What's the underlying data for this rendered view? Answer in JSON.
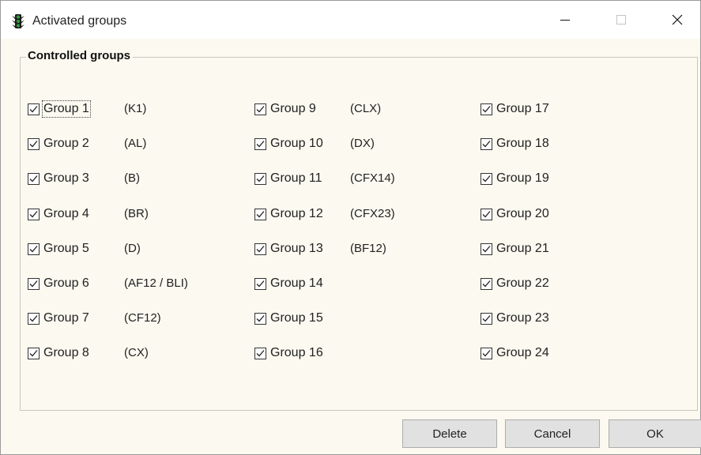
{
  "window": {
    "title": "Activated groups",
    "icon": "traffic-light-icon"
  },
  "groupbox": {
    "legend": "Controlled groups"
  },
  "columns": [
    {
      "items": [
        {
          "label": "Group 1",
          "code": "(K1)",
          "checked": true,
          "focused": true
        },
        {
          "label": "Group 2",
          "code": "(AL)",
          "checked": true
        },
        {
          "label": "Group 3",
          "code": "(B)",
          "checked": true
        },
        {
          "label": "Group 4",
          "code": "(BR)",
          "checked": true
        },
        {
          "label": "Group 5",
          "code": "(D)",
          "checked": true
        },
        {
          "label": "Group 6",
          "code": "(AF12 / BLI)",
          "checked": true
        },
        {
          "label": "Group 7",
          "code": "(CF12)",
          "checked": true
        },
        {
          "label": "Group 8",
          "code": "(CX)",
          "checked": true
        }
      ]
    },
    {
      "items": [
        {
          "label": "Group 9",
          "code": "(CLX)",
          "checked": true
        },
        {
          "label": "Group 10",
          "code": "(DX)",
          "checked": true
        },
        {
          "label": "Group 11",
          "code": "(CFX14)",
          "checked": true
        },
        {
          "label": "Group 12",
          "code": "(CFX23)",
          "checked": true
        },
        {
          "label": "Group 13",
          "code": "(BF12)",
          "checked": true
        },
        {
          "label": "Group 14",
          "code": "",
          "checked": true
        },
        {
          "label": "Group 15",
          "code": "",
          "checked": true
        },
        {
          "label": "Group 16",
          "code": "",
          "checked": true
        }
      ]
    },
    {
      "items": [
        {
          "label": "Group 17",
          "code": "",
          "checked": true
        },
        {
          "label": "Group 18",
          "code": "",
          "checked": true
        },
        {
          "label": "Group 19",
          "code": "",
          "checked": true
        },
        {
          "label": "Group 20",
          "code": "",
          "checked": true
        },
        {
          "label": "Group 21",
          "code": "",
          "checked": true
        },
        {
          "label": "Group 22",
          "code": "",
          "checked": true
        },
        {
          "label": "Group 23",
          "code": "",
          "checked": true
        },
        {
          "label": "Group 24",
          "code": "",
          "checked": true
        }
      ]
    }
  ],
  "buttons": {
    "delete": "Delete",
    "cancel": "Cancel",
    "ok": "OK"
  }
}
